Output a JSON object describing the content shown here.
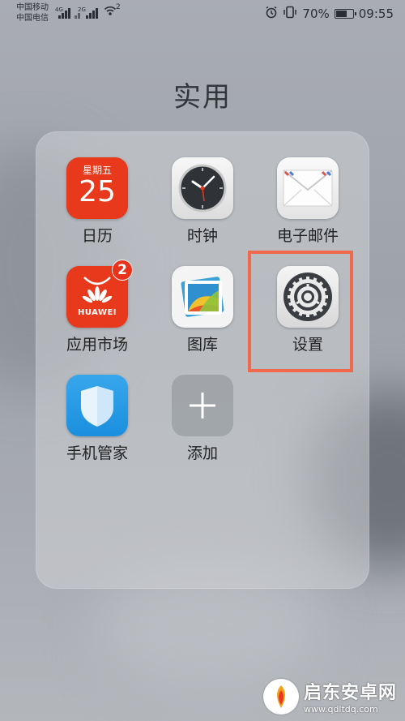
{
  "status_bar": {
    "carrier_1": "中国移动",
    "carrier_2": "中国电信",
    "net_1": "4G",
    "net_2": "2G",
    "hotspot_count": "2",
    "battery_percent": "70%",
    "battery_level": 0.7,
    "time": "09:55",
    "icons": [
      "alarm-icon",
      "vibrate-icon",
      "battery-icon",
      "wifi-hotspot-icon"
    ]
  },
  "folder": {
    "title": "实用",
    "apps": [
      {
        "label": "日历",
        "icon": "calendar-icon",
        "calendar_weekday": "星期五",
        "calendar_day": "25"
      },
      {
        "label": "时钟",
        "icon": "clock-icon"
      },
      {
        "label": "电子邮件",
        "icon": "mail-envelope-icon"
      },
      {
        "label": "应用市场",
        "icon": "huawei-appgallery-icon",
        "brand": "HUAWEI",
        "badge": "2"
      },
      {
        "label": "图库",
        "icon": "gallery-photo-icon"
      },
      {
        "label": "设置",
        "icon": "gear-icon"
      },
      {
        "label": "手机管家",
        "icon": "shield-icon"
      },
      {
        "label": "添加",
        "icon": "plus-icon"
      }
    ]
  },
  "highlight_color": "#f0694a",
  "watermark": {
    "name": "启东安卓网",
    "url": "www.qdltdq.com"
  }
}
